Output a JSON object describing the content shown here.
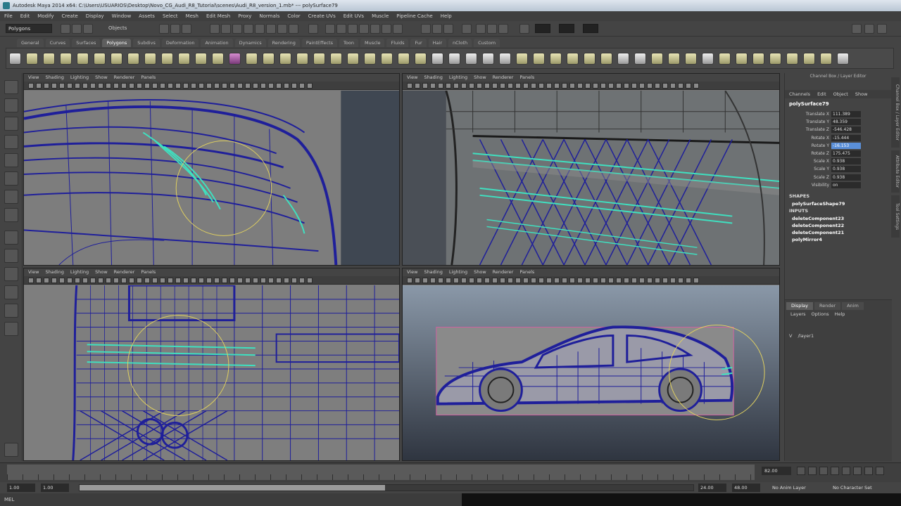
{
  "window": {
    "title": "Autodesk Maya 2014 x64: C:\\Users\\USUARIOS\\Desktop\\Novo_CG_Audi_R8_Tutorial\\scenes\\Audi_R8_version_1.mb* --- polySurface79"
  },
  "menubar": [
    "File",
    "Edit",
    "Modify",
    "Create",
    "Display",
    "Window",
    "Assets",
    "Select",
    "Mesh",
    "Edit Mesh",
    "Proxy",
    "Normals",
    "Color",
    "Create UVs",
    "Edit UVs",
    "Muscle",
    "Pipeline Cache",
    "Help"
  ],
  "statusline": {
    "menu_set": "Polygons",
    "object_mode": "Objects"
  },
  "shelf_tabs": [
    "General",
    "Curves",
    "Surfaces",
    "Polygons",
    "Subdivs",
    "Deformation",
    "Animation",
    "Dynamics",
    "Rendering",
    "PaintEffects",
    "Toon",
    "Muscle",
    "Fluids",
    "Fur",
    "Hair",
    "nCloth",
    "Custom"
  ],
  "shelf_active_tab": "Polygons",
  "viewport_menu": [
    "View",
    "Shading",
    "Lighting",
    "Show",
    "Renderer",
    "Panels"
  ],
  "colors": {
    "wire": "#1f1f9a",
    "highlight": "#3fe0c0",
    "manip": "#e0d060",
    "viewport_bg": "#7a7a7a",
    "selection": "#5a8fd8"
  },
  "channel_box": {
    "panel_title": "Channel Box / Layer Editor",
    "menu": [
      "Channels",
      "Edit",
      "Object",
      "Show"
    ],
    "object_name": "polySurface79",
    "attributes": [
      {
        "label": "Translate X",
        "value": "111.389",
        "selected": false
      },
      {
        "label": "Translate Y",
        "value": "48.359",
        "selected": false
      },
      {
        "label": "Translate Z",
        "value": "-546.428",
        "selected": false
      },
      {
        "label": "Rotate X",
        "value": "-15.444",
        "selected": false
      },
      {
        "label": "Rotate Y",
        "value": "-16.153",
        "selected": true
      },
      {
        "label": "Rotate Z",
        "value": "175.475",
        "selected": false
      },
      {
        "label": "Scale X",
        "value": "0.938",
        "selected": false
      },
      {
        "label": "Scale Y",
        "value": "0.938",
        "selected": false
      },
      {
        "label": "Scale Z",
        "value": "0.938",
        "selected": false
      },
      {
        "label": "Visibility",
        "value": "on",
        "selected": false
      }
    ],
    "shapes_title": "SHAPES",
    "shapes": [
      "polySurfaceShape79"
    ],
    "inputs_title": "INPUTS",
    "inputs": [
      "deleteComponent23",
      "deleteComponent22",
      "deleteComponent21",
      "polyMirror4"
    ]
  },
  "layer_editor": {
    "tabs": [
      "Display",
      "Render",
      "Anim"
    ],
    "active_tab": "Display",
    "menu": [
      "Layers",
      "Options",
      "Help"
    ],
    "layer": {
      "visible": "V",
      "name": "/layer1"
    }
  },
  "side_tabs": [
    "Channel Box / Layer Editor",
    "Attribute Editor",
    "Tool Settings"
  ],
  "time_slider": {
    "current_time": "82.00"
  },
  "range_slider": {
    "start": "1.00",
    "playback_start": "1.00",
    "playback_end": "24.00",
    "end": "48.00",
    "anim_layer": "No Anim Layer",
    "character_set": "No Character Set"
  },
  "help_line": {
    "text": "MEL"
  }
}
